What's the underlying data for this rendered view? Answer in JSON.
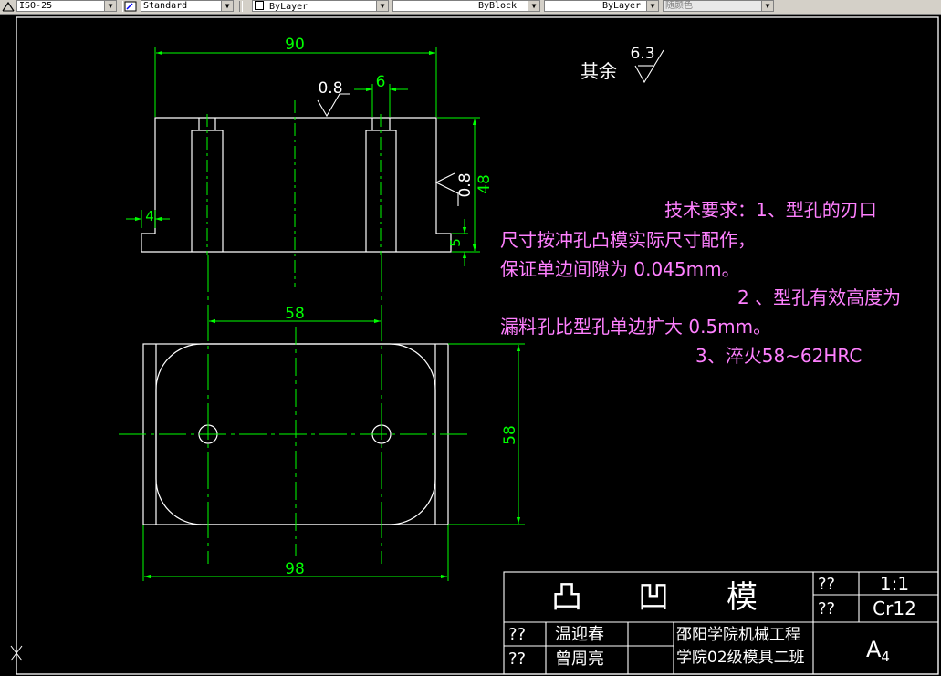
{
  "toolbar": {
    "dimstyle": "ISO-25",
    "textstyle": "Standard",
    "layer": "ByLayer",
    "linetype": "ByBlock",
    "lineweight": "ByLayer",
    "color": "随颜色"
  },
  "drawing": {
    "dims": {
      "width_top": "90",
      "hole_dia": "6",
      "roughness_a": "0.8",
      "height_total": "48",
      "roughness_b": "0.8",
      "step_left": "4",
      "step_bottom": "5",
      "hole_spacing": "58",
      "plan_height": "58",
      "plan_width": "98"
    },
    "roughness_other_label": "其余",
    "roughness_other_value": "6.3",
    "notes": [
      "技术要求：1、型孔的刃口",
      "尺寸按冲孔凸模实际尺寸配作，",
      "保证单边间隙为 0.045mm。",
      "2 、型孔有效高度为",
      "漏料孔比型孔单边扩大 0.5mm。",
      "3、淬火58~62HRC"
    ]
  },
  "title_block": {
    "part_name": [
      "凸",
      "凹",
      "模"
    ],
    "scale_label": "??",
    "scale": "1:1",
    "material_label": "??",
    "material": "Cr12",
    "designer_label": "??",
    "designer": "温迎春",
    "checker_label": "??",
    "checker": "曾周亮",
    "school_line1": "邵阳学院机械工程",
    "school_line2": "学院02级模具二班",
    "sheet": "A",
    "sheet_sub": "4"
  },
  "colors": {
    "background": "#000000",
    "outline": "#ffffff",
    "dimension": "#00ff00",
    "centerline": "#00ff00",
    "notes": "#ff80ff"
  }
}
